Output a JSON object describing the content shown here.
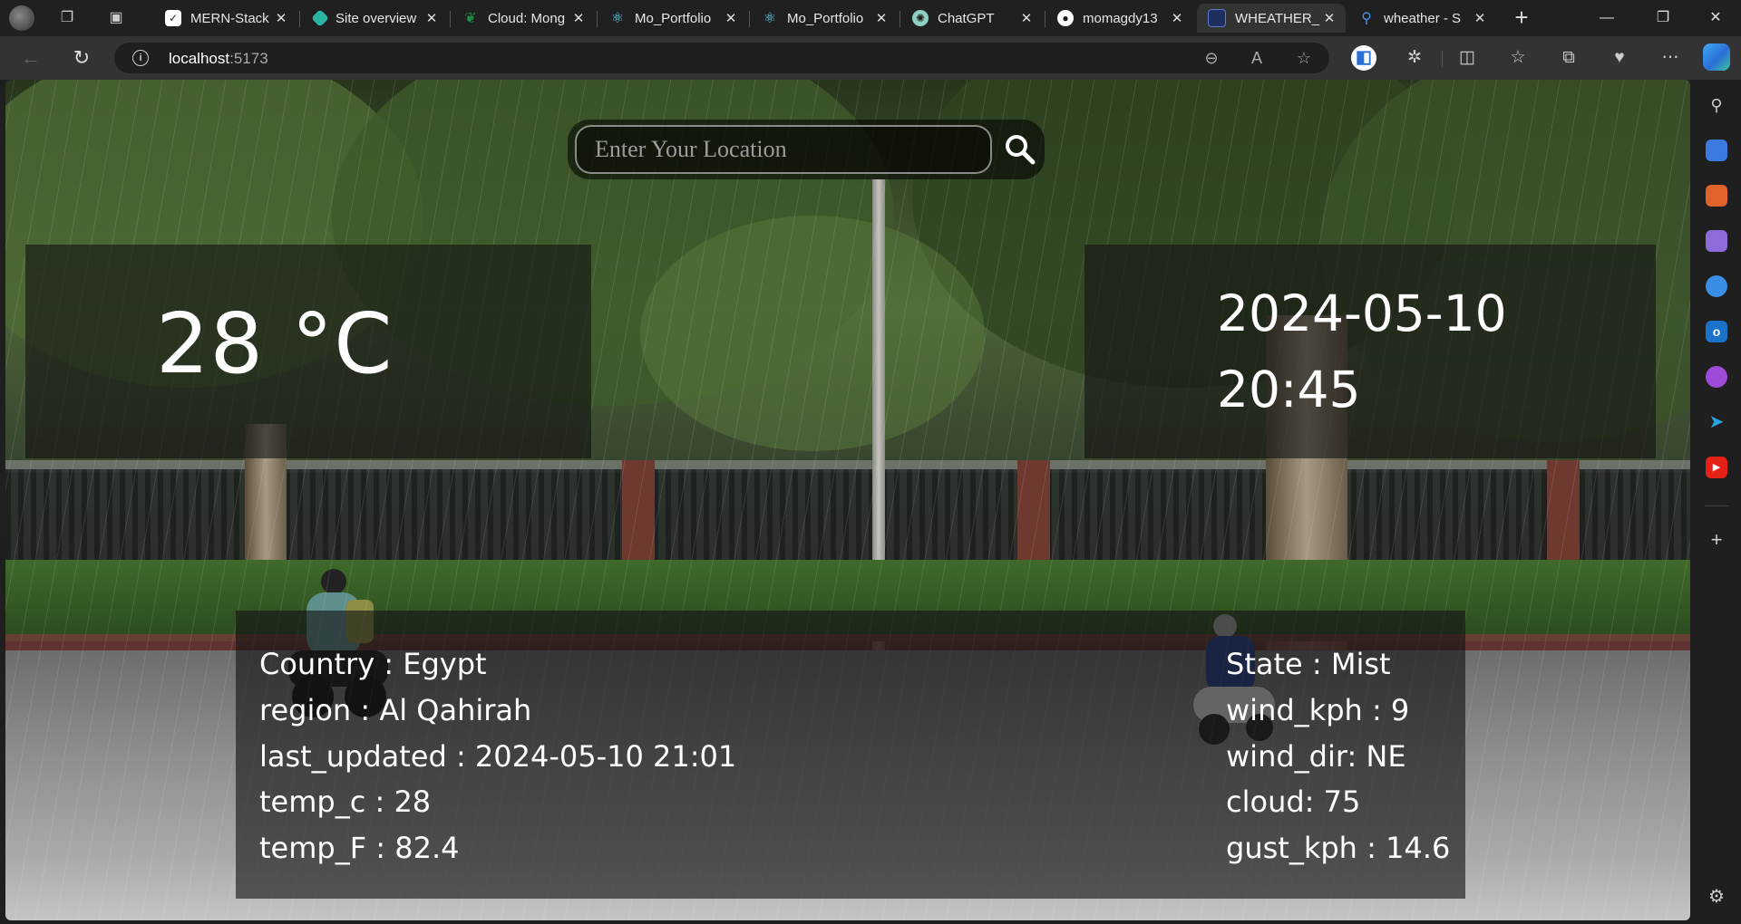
{
  "browser": {
    "tabs": [
      {
        "title": "MERN-Stack",
        "icon": "check-doc-icon",
        "color": "#e8e8e8",
        "active": false
      },
      {
        "title": "Site overview",
        "icon": "netlify-icon",
        "color": "#2bb3a3",
        "active": false
      },
      {
        "title": "Cloud: Mong",
        "icon": "mongodb-leaf-icon",
        "color": "#1a8d45",
        "active": false
      },
      {
        "title": "Mo_Portfolio",
        "icon": "react-icon",
        "color": "#61dafb",
        "active": false
      },
      {
        "title": "Mo_Portfolio",
        "icon": "react-icon",
        "color": "#61dafb",
        "active": false
      },
      {
        "title": "ChatGPT",
        "icon": "chatgpt-icon",
        "color": "#8fd1c0",
        "active": false
      },
      {
        "title": "momagdy13",
        "icon": "github-icon",
        "color": "#ffffff",
        "active": false
      },
      {
        "title": "WHEATHER_",
        "icon": "app-thumbnail-icon",
        "color": "#1c2f5f",
        "active": true
      },
      {
        "title": "wheather - S",
        "icon": "search-icon",
        "color": "#4a8fe7",
        "active": false
      }
    ],
    "new_tab": "+",
    "address": {
      "host": "localhost",
      "port": ":5173"
    }
  },
  "app": {
    "search": {
      "placeholder": "Enter Your Location",
      "value": ""
    },
    "temperature_display": "28 °C",
    "date": "2024-05-10",
    "time": "20:45",
    "details_left": [
      {
        "label": "Country : ",
        "value": "Egypt"
      },
      {
        "label": "region : ",
        "value": "Al Qahirah"
      },
      {
        "label": "last_updated : ",
        "value": "2024-05-10 21:01"
      },
      {
        "label": "temp_c : ",
        "value": "28"
      },
      {
        "label": "temp_F : ",
        "value": "82.4"
      }
    ],
    "details_right": [
      {
        "label": "State : ",
        "value": "Mist"
      },
      {
        "label": "wind_kph : ",
        "value": "9"
      },
      {
        "label": "wind_dir: ",
        "value": "NE"
      },
      {
        "label": "cloud: ",
        "value": "75"
      },
      {
        "label": "gust_kph : ",
        "value": "14.6"
      }
    ]
  }
}
